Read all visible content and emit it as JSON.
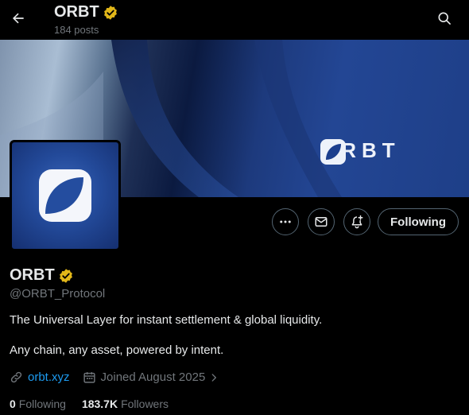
{
  "header": {
    "name": "ORBT",
    "post_count": "184 posts"
  },
  "banner": {
    "brand_text": "ORBT"
  },
  "actions": {
    "follow_label": "Following"
  },
  "profile": {
    "name": "ORBT",
    "handle": "@ORBT_Protocol",
    "bio_line1": "The Universal Layer for instant settlement & global liquidity.",
    "bio_line2": "Any chain, any asset, powered by intent.",
    "website": "orbt.xyz",
    "joined": "Joined August 2025",
    "following_count": "0",
    "following_label": "Following",
    "followers_count": "183.7K",
    "followers_label": "Followers"
  },
  "icons": {
    "back": "arrow-left-icon",
    "search": "search-icon",
    "verified": "verified-badge-icon",
    "more": "more-icon",
    "message": "mail-icon",
    "notify": "bell-plus-icon",
    "link": "link-icon",
    "calendar": "calendar-icon"
  },
  "colors": {
    "background": "#000000",
    "text": "#e7e9ea",
    "muted": "#71767b",
    "link": "#1d9bf0",
    "verified": "#e2b719",
    "border": "#536471"
  }
}
